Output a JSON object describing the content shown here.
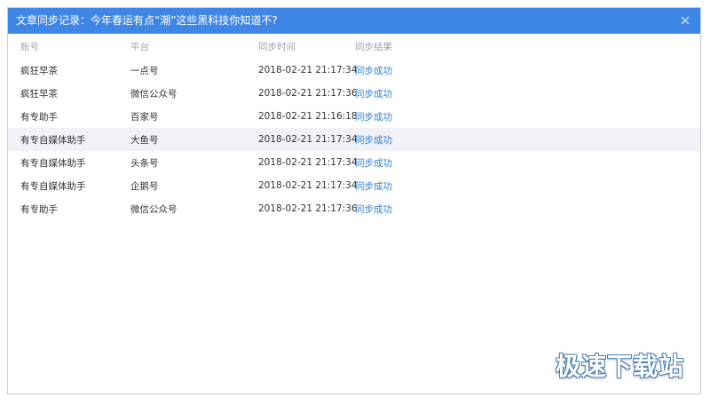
{
  "window": {
    "title": "文章同步记录：今年春运有点“潮”这些黑科技你知道不?"
  },
  "icons": {
    "close": "close-icon"
  },
  "colors": {
    "titlebar": "#3f87e6",
    "result_link": "#2f7fd8",
    "header_text": "#9aa3ad",
    "highlight_row": "#f0f2f7"
  },
  "table": {
    "headers": {
      "account": "账号",
      "platform": "平台",
      "sync_time": "同步时间",
      "sync_result": "同步结果"
    },
    "rows": [
      {
        "account": "疯狂早茶",
        "platform": "一点号",
        "sync_time": "2018-02-21 21:17:34",
        "sync_result": "同步成功"
      },
      {
        "account": "疯狂早茶",
        "platform": "微信公众号",
        "sync_time": "2018-02-21 21:17:36",
        "sync_result": "同步成功"
      },
      {
        "account": "有专助手",
        "platform": "百家号",
        "sync_time": "2018-02-21 21:16:18",
        "sync_result": "同步成功"
      },
      {
        "account": "有专自媒体助手",
        "platform": "大鱼号",
        "sync_time": "2018-02-21 21:17:34",
        "sync_result": "同步成功"
      },
      {
        "account": "有专自媒体助手",
        "platform": "头条号",
        "sync_time": "2018-02-21 21:17:34",
        "sync_result": "同步成功"
      },
      {
        "account": "有专自媒体助手",
        "platform": "企鹅号",
        "sync_time": "2018-02-21 21:17:34",
        "sync_result": "同步成功"
      },
      {
        "account": "有专助手",
        "platform": "微信公众号",
        "sync_time": "2018-02-21 21:17:36",
        "sync_result": "同步成功"
      }
    ]
  },
  "watermark": {
    "text": "极速下载站"
  }
}
